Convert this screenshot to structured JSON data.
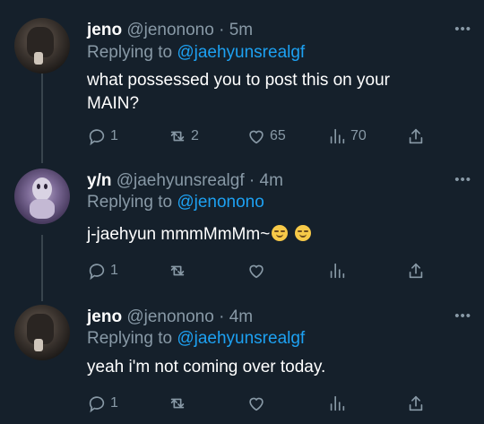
{
  "tweets": [
    {
      "display_name": "jeno",
      "handle": "@jenonono",
      "time": "· 5m",
      "replying_prefix": "Replying to",
      "replying_to": "@jaehyunsrealgf",
      "text": "what possessed you to post this on your MAIN?",
      "replies": "1",
      "retweets": "2",
      "likes": "65",
      "views": "70",
      "avatar": "jeno"
    },
    {
      "display_name": "y/n",
      "handle": "@jaehyunsrealgf",
      "time": "· 4m",
      "replying_prefix": "Replying to",
      "replying_to": "@jenonono",
      "text": "j-jaehyun mmmMmMm~",
      "replies": "1",
      "retweets": "",
      "likes": "",
      "views": "",
      "avatar": "yn"
    },
    {
      "display_name": "jeno",
      "handle": "@jenonono",
      "time": "· 4m",
      "replying_prefix": "Replying to",
      "replying_to": "@jaehyunsrealgf",
      "text": "yeah i'm not coming over today.",
      "replies": "1",
      "retweets": "",
      "likes": "",
      "views": "",
      "avatar": "jeno"
    }
  ],
  "colors": {
    "background": "#15202b",
    "muted": "#8899a6",
    "link": "#1da1f2",
    "thread_line": "#38444d"
  },
  "icons": [
    "reply-icon",
    "retweet-icon",
    "like-icon",
    "views-icon",
    "share-icon",
    "more-icon"
  ]
}
